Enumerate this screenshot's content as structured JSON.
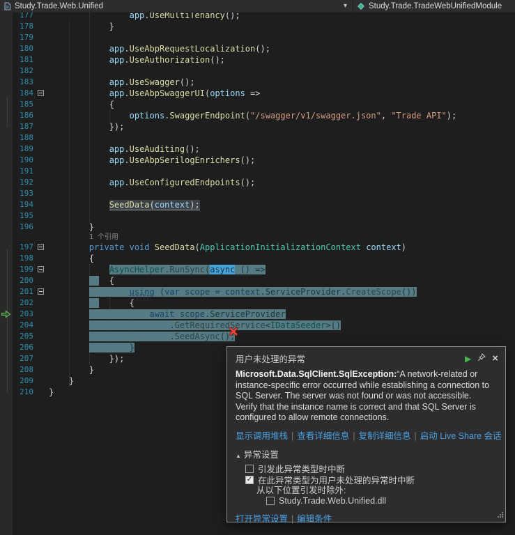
{
  "nav": {
    "left_label": "Study.Trade.Web.Unified",
    "right_label": "Study.Trade.TradeWebUnifiedModule"
  },
  "editor": {
    "lines": [
      {
        "num": 177,
        "t": [
          [
            "n",
            "                "
          ],
          [
            "v",
            "app"
          ],
          [
            "n",
            "."
          ],
          [
            "m",
            "UseMultiTenancy"
          ],
          [
            "n",
            "();"
          ]
        ]
      },
      {
        "num": 178,
        "t": [
          [
            "n",
            "            "
          ],
          [
            "n",
            "}"
          ]
        ]
      },
      {
        "num": 179,
        "t": []
      },
      {
        "num": 180,
        "t": [
          [
            "n",
            "            "
          ],
          [
            "v",
            "app"
          ],
          [
            "n",
            "."
          ],
          [
            "m",
            "UseAbpRequestLocalization"
          ],
          [
            "n",
            "();"
          ]
        ]
      },
      {
        "num": 181,
        "t": [
          [
            "n",
            "            "
          ],
          [
            "v",
            "app"
          ],
          [
            "n",
            "."
          ],
          [
            "m",
            "UseAuthorization"
          ],
          [
            "n",
            "();"
          ]
        ]
      },
      {
        "num": 182,
        "t": []
      },
      {
        "num": 183,
        "t": [
          [
            "n",
            "            "
          ],
          [
            "v",
            "app"
          ],
          [
            "n",
            "."
          ],
          [
            "m",
            "UseSwagger"
          ],
          [
            "n",
            "();"
          ]
        ]
      },
      {
        "num": 184,
        "fold": true,
        "t": [
          [
            "n",
            "            "
          ],
          [
            "v",
            "app"
          ],
          [
            "n",
            "."
          ],
          [
            "m",
            "UseAbpSwaggerUI"
          ],
          [
            "n",
            "("
          ],
          [
            "v",
            "options"
          ],
          [
            "n",
            " =>"
          ]
        ]
      },
      {
        "num": 185,
        "t": [
          [
            "n",
            "            "
          ],
          [
            "n",
            "{"
          ]
        ]
      },
      {
        "num": 186,
        "t": [
          [
            "n",
            "                "
          ],
          [
            "v",
            "options"
          ],
          [
            "n",
            "."
          ],
          [
            "m",
            "SwaggerEndpoint"
          ],
          [
            "n",
            "("
          ],
          [
            "s",
            "\"/swagger/v1/swagger.json\""
          ],
          [
            "n",
            ", "
          ],
          [
            "s",
            "\"Trade API\""
          ],
          [
            "n",
            ");"
          ]
        ]
      },
      {
        "num": 187,
        "t": [
          [
            "n",
            "            "
          ],
          [
            "n",
            "});"
          ]
        ]
      },
      {
        "num": 188,
        "t": []
      },
      {
        "num": 189,
        "t": [
          [
            "n",
            "            "
          ],
          [
            "v",
            "app"
          ],
          [
            "n",
            "."
          ],
          [
            "m",
            "UseAuditing"
          ],
          [
            "n",
            "();"
          ]
        ]
      },
      {
        "num": 190,
        "t": [
          [
            "n",
            "            "
          ],
          [
            "v",
            "app"
          ],
          [
            "n",
            "."
          ],
          [
            "m",
            "UseAbpSerilogEnrichers"
          ],
          [
            "n",
            "();"
          ]
        ]
      },
      {
        "num": 191,
        "t": []
      },
      {
        "num": 192,
        "t": [
          [
            "n",
            "            "
          ],
          [
            "v",
            "app"
          ],
          [
            "n",
            "."
          ],
          [
            "m",
            "UseConfiguredEndpoints"
          ],
          [
            "n",
            "();"
          ]
        ]
      },
      {
        "num": 193,
        "t": []
      },
      {
        "num": 194,
        "t": [
          [
            "n",
            "            "
          ],
          [
            "m g",
            "SeedData"
          ],
          [
            "n g",
            "("
          ],
          [
            "v g",
            "context"
          ],
          [
            "n g",
            ");"
          ]
        ]
      },
      {
        "num": 195,
        "t": []
      },
      {
        "num": 196,
        "t": [
          [
            "n",
            "        "
          ],
          [
            "n",
            "}"
          ]
        ]
      },
      {
        "num": 197,
        "lens": "1 个引用",
        "fold": true,
        "t": [
          [
            "n",
            "        "
          ],
          [
            "k",
            "private"
          ],
          [
            "n",
            " "
          ],
          [
            "k",
            "void"
          ],
          [
            "n",
            " "
          ],
          [
            "m",
            "SeedData"
          ],
          [
            "n",
            "("
          ],
          [
            "t",
            "ApplicationInitializationContext"
          ],
          [
            "n",
            " "
          ],
          [
            "v",
            "context"
          ],
          [
            "n",
            ")"
          ]
        ]
      },
      {
        "num": 198,
        "t": [
          [
            "n",
            "        "
          ],
          [
            "n",
            "{"
          ]
        ]
      },
      {
        "num": 199,
        "fold": true,
        "t": [
          [
            "n",
            "            "
          ],
          [
            "t h",
            "AsyncHelper"
          ],
          [
            "n h",
            "."
          ],
          [
            "m h",
            "RunSync"
          ],
          [
            "n h",
            "("
          ],
          [
            "k a",
            "async"
          ],
          [
            "n h",
            " () =>"
          ]
        ]
      },
      {
        "num": 200,
        "t": [
          [
            "n",
            "        "
          ],
          [
            "h",
            "  "
          ],
          [
            "n",
            "  "
          ],
          [
            "n",
            "{"
          ]
        ]
      },
      {
        "num": 201,
        "fold": true,
        "t": [
          [
            "n",
            "        "
          ],
          [
            "h",
            "        "
          ],
          [
            "k h u2",
            "using"
          ],
          [
            "n h",
            " ("
          ],
          [
            "k h",
            "var"
          ],
          [
            "n h",
            " "
          ],
          [
            "v h",
            "scope"
          ],
          [
            "n h",
            " = "
          ],
          [
            "v h",
            "context"
          ],
          [
            "n h",
            "."
          ],
          [
            "n h",
            "ServiceProvider"
          ],
          [
            "n h",
            "."
          ],
          [
            "m h",
            "CreateScope"
          ],
          [
            "n h",
            "())"
          ]
        ]
      },
      {
        "num": 202,
        "t": [
          [
            "n",
            "        "
          ],
          [
            "h",
            "  "
          ],
          [
            "n",
            "      "
          ],
          [
            "n",
            "{"
          ]
        ]
      },
      {
        "num": 203,
        "arrow": true,
        "t": [
          [
            "n",
            "        "
          ],
          [
            "h",
            "            "
          ],
          [
            "k h",
            "await"
          ],
          [
            "n h",
            " "
          ],
          [
            "v h",
            "scope"
          ],
          [
            "n h",
            "."
          ],
          [
            "n h",
            "ServiceProvider"
          ]
        ]
      },
      {
        "num": 204,
        "t": [
          [
            "n",
            "        "
          ],
          [
            "h",
            "                "
          ],
          [
            "n h",
            "."
          ],
          [
            "m h",
            "GetRequiredService"
          ],
          [
            "n h",
            "<"
          ],
          [
            "t h",
            "IDataSeeder"
          ],
          [
            "n h",
            ">()"
          ]
        ]
      },
      {
        "num": 205,
        "t": [
          [
            "n",
            "        "
          ],
          [
            "h",
            "                "
          ],
          [
            "n h",
            "."
          ],
          [
            "m h",
            "SeedAsync"
          ],
          [
            "n h",
            "();"
          ]
        ]
      },
      {
        "num": 206,
        "t": [
          [
            "n",
            "        "
          ],
          [
            "h",
            "        }"
          ]
        ]
      },
      {
        "num": 207,
        "t": [
          [
            "n",
            "            "
          ],
          [
            "n",
            "});"
          ]
        ]
      },
      {
        "num": 208,
        "t": [
          [
            "n",
            "        "
          ],
          [
            "n",
            "}"
          ]
        ]
      },
      {
        "num": 209,
        "t": [
          [
            "n",
            "    "
          ],
          [
            "n",
            "}"
          ]
        ]
      },
      {
        "num": 210,
        "t": [
          [
            "n",
            "}"
          ]
        ]
      }
    ]
  },
  "popup": {
    "title": "用户未处理的异常",
    "exception_type": "Microsoft.Data.SqlClient.SqlException:",
    "message": "“A network-related or instance-specific error occurred while establishing a connection to SQL Server. The server was not found or was not accessible. Verify that the instance name is correct and that SQL Server is configured to allow remote connections.",
    "links": [
      "显示调用堆栈",
      "查看详细信息",
      "复制详细信息",
      "启动 Live Share 会话"
    ],
    "settings": {
      "header": "异常设置",
      "checkboxes": [
        {
          "label": "引发此异常类型时中断",
          "checked": false
        },
        {
          "label": "在此异常类型为用户未处理的异常时中断",
          "checked": true
        }
      ],
      "except_label": "从以下位置引发时除外:",
      "module_checkbox": {
        "label": "Study.Trade.Web.Unified.dll",
        "checked": false
      },
      "footer_links": [
        "打开异常设置",
        "编辑条件"
      ]
    }
  },
  "colors": {
    "background": "#1e1e1e",
    "navbar": "#2d2d30",
    "line_number": "#2b91af",
    "keyword": "#569cd6",
    "type": "#4ec9b0",
    "string": "#d69d85",
    "method": "#dcdcaa",
    "local": "#9cdcfe",
    "debug_highlight": "#567b82",
    "link": "#4ba1e2",
    "error": "#e0483d",
    "continue_green": "#41b64b"
  }
}
